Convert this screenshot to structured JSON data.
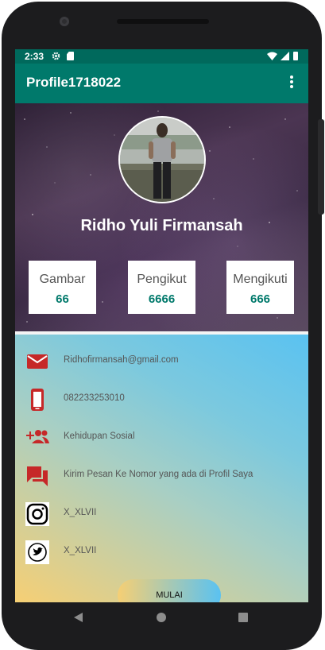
{
  "status_bar": {
    "time": "2:33"
  },
  "app_bar": {
    "title": "Profile1718022"
  },
  "profile": {
    "name": "Ridho Yuli Firmansah",
    "stats": [
      {
        "label": "Gambar",
        "value": "66"
      },
      {
        "label": "Pengikut",
        "value": "6666"
      },
      {
        "label": "Mengikuti",
        "value": "666"
      }
    ]
  },
  "contacts": [
    {
      "icon": "email-icon",
      "text": "Ridhofirmansah@gmail.com"
    },
    {
      "icon": "phone-icon",
      "text": "082233253010"
    },
    {
      "icon": "group-add-icon",
      "text": "Kehidupan Sosial"
    },
    {
      "icon": "forum-icon",
      "text": "Kirim Pesan Ke Nomor yang ada di Profil Saya"
    },
    {
      "icon": "instagram-icon",
      "text": "X_XLVII"
    },
    {
      "icon": "twitter-icon",
      "text": "X_XLVII"
    }
  ],
  "action": {
    "mulai_label": "MULAI"
  },
  "colors": {
    "primary": "#00796b",
    "primary_dark": "#00695c",
    "icon_red": "#c62828",
    "gradient_start": "#f6cf74",
    "gradient_end": "#5ac2f1"
  }
}
